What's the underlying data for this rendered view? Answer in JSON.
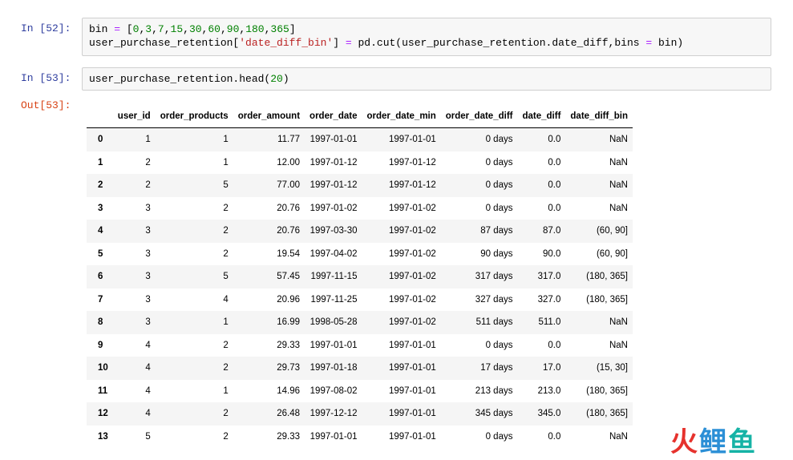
{
  "cells": [
    {
      "prompt": "In [52]:",
      "lines": [
        [
          {
            "t": "var",
            "v": "bin "
          },
          {
            "t": "op",
            "v": "="
          },
          {
            "t": "punc",
            "v": " ["
          },
          {
            "t": "num",
            "v": "0"
          },
          {
            "t": "punc",
            "v": ","
          },
          {
            "t": "num",
            "v": "3"
          },
          {
            "t": "punc",
            "v": ","
          },
          {
            "t": "num",
            "v": "7"
          },
          {
            "t": "punc",
            "v": ","
          },
          {
            "t": "num",
            "v": "15"
          },
          {
            "t": "punc",
            "v": ","
          },
          {
            "t": "num",
            "v": "30"
          },
          {
            "t": "punc",
            "v": ","
          },
          {
            "t": "num",
            "v": "60"
          },
          {
            "t": "punc",
            "v": ","
          },
          {
            "t": "num",
            "v": "90"
          },
          {
            "t": "punc",
            "v": ","
          },
          {
            "t": "num",
            "v": "180"
          },
          {
            "t": "punc",
            "v": ","
          },
          {
            "t": "num",
            "v": "365"
          },
          {
            "t": "punc",
            "v": "]"
          }
        ],
        [
          {
            "t": "var",
            "v": "user_purchase_retention["
          },
          {
            "t": "str",
            "v": "'date_diff_bin'"
          },
          {
            "t": "var",
            "v": "] "
          },
          {
            "t": "op",
            "v": "="
          },
          {
            "t": "var",
            "v": " pd.cut(user_purchase_retention.date_diff,bins "
          },
          {
            "t": "op",
            "v": "="
          },
          {
            "t": "var",
            "v": " bin)"
          }
        ]
      ]
    },
    {
      "prompt": "In [53]:",
      "lines": [
        [
          {
            "t": "var",
            "v": "user_purchase_retention.head("
          },
          {
            "t": "num",
            "v": "20"
          },
          {
            "t": "var",
            "v": ")"
          }
        ]
      ]
    }
  ],
  "output": {
    "prompt": "Out[53]:",
    "columns": [
      "",
      "user_id",
      "order_products",
      "order_amount",
      "order_date",
      "order_date_min",
      "order_date_diff",
      "date_diff",
      "date_diff_bin"
    ],
    "rows": [
      [
        "0",
        "1",
        "1",
        "11.77",
        "1997-01-01",
        "1997-01-01",
        "0 days",
        "0.0",
        "NaN"
      ],
      [
        "1",
        "2",
        "1",
        "12.00",
        "1997-01-12",
        "1997-01-12",
        "0 days",
        "0.0",
        "NaN"
      ],
      [
        "2",
        "2",
        "5",
        "77.00",
        "1997-01-12",
        "1997-01-12",
        "0 days",
        "0.0",
        "NaN"
      ],
      [
        "3",
        "3",
        "2",
        "20.76",
        "1997-01-02",
        "1997-01-02",
        "0 days",
        "0.0",
        "NaN"
      ],
      [
        "4",
        "3",
        "2",
        "20.76",
        "1997-03-30",
        "1997-01-02",
        "87 days",
        "87.0",
        "(60, 90]"
      ],
      [
        "5",
        "3",
        "2",
        "19.54",
        "1997-04-02",
        "1997-01-02",
        "90 days",
        "90.0",
        "(60, 90]"
      ],
      [
        "6",
        "3",
        "5",
        "57.45",
        "1997-11-15",
        "1997-01-02",
        "317 days",
        "317.0",
        "(180, 365]"
      ],
      [
        "7",
        "3",
        "4",
        "20.96",
        "1997-11-25",
        "1997-01-02",
        "327 days",
        "327.0",
        "(180, 365]"
      ],
      [
        "8",
        "3",
        "1",
        "16.99",
        "1998-05-28",
        "1997-01-02",
        "511 days",
        "511.0",
        "NaN"
      ],
      [
        "9",
        "4",
        "2",
        "29.33",
        "1997-01-01",
        "1997-01-01",
        "0 days",
        "0.0",
        "NaN"
      ],
      [
        "10",
        "4",
        "2",
        "29.73",
        "1997-01-18",
        "1997-01-01",
        "17 days",
        "17.0",
        "(15, 30]"
      ],
      [
        "11",
        "4",
        "1",
        "14.96",
        "1997-08-02",
        "1997-01-01",
        "213 days",
        "213.0",
        "(180, 365]"
      ],
      [
        "12",
        "4",
        "2",
        "26.48",
        "1997-12-12",
        "1997-01-01",
        "345 days",
        "345.0",
        "(180, 365]"
      ],
      [
        "13",
        "5",
        "2",
        "29.33",
        "1997-01-01",
        "1997-01-01",
        "0 days",
        "0.0",
        "NaN"
      ]
    ]
  },
  "watermark": {
    "c1": "火",
    "c2": "鲤",
    "c3": "鱼"
  },
  "colors": {
    "in_prompt": "#303f9f",
    "out_prompt": "#d84315",
    "input_bg": "#f7f7f7",
    "string": "#ba2121",
    "number": "#008000",
    "operator": "#aa22ff"
  }
}
